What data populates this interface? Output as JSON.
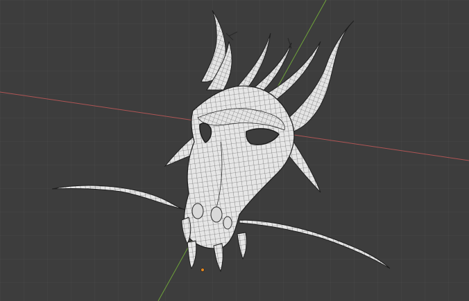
{
  "viewport": {
    "mode": "wireframe-overlay",
    "background_color": "#3d3d3d",
    "mesh_fill_color": "#e6e6e6",
    "mesh_wire_color": "#4a4a4a",
    "mesh_outline_color": "#1e1e1e",
    "x_axis_color": "#b05555",
    "y_axis_color": "#6fa43a",
    "origin_color": "#e0851f"
  },
  "object": {
    "icon": "mesh-icon",
    "type": "sculpt-mesh"
  }
}
